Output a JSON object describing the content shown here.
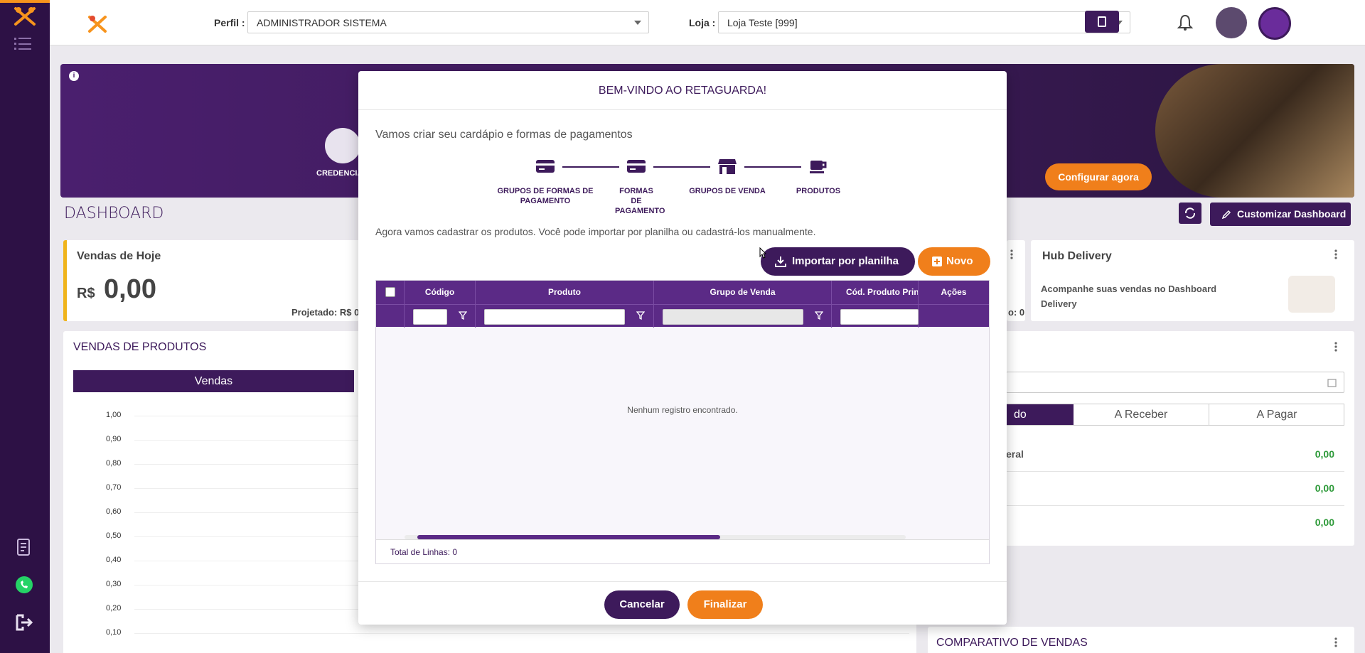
{
  "topbar": {
    "perfil_label": "Perfil :",
    "perfil_value": "ADMINISTRADOR SISTEMA",
    "loja_label": "Loja :",
    "loja_value": "Loja Teste [999]"
  },
  "colors": {
    "brand": "#3d1a5b",
    "accent": "#f07f1b",
    "sidebar": "#2d1145"
  },
  "banner": {
    "credenciar_label": "CREDENCIAR",
    "configure_button": "Configurar agora"
  },
  "dashboard": {
    "title": "DASHBOARD",
    "customize_button": "Customizar Dashboard",
    "vendas_hoje": {
      "title": "Vendas de Hoje",
      "currency": "R$",
      "value": "0,00",
      "projected": "Projetado: R$ 0"
    },
    "hub_delivery": {
      "title": "Hub Delivery",
      "text": "Acompanhe suas vendas no Dashboard Delivery"
    },
    "hub_partial": "o: 0",
    "vendas_produtos": {
      "title": "VENDAS DE PRODUTOS",
      "tab": "Vendas",
      "y_ticks": [
        "1,00",
        "0,90",
        "0,80",
        "0,70",
        "0,60",
        "0,50",
        "0,40",
        "0,30",
        "0,20",
        "0,10"
      ]
    },
    "finance": {
      "tabs": [
        "do",
        "A Receber",
        "A Pagar"
      ],
      "rows": [
        {
          "label": "eral",
          "value": "0,00"
        },
        {
          "label": "",
          "value": "0,00"
        },
        {
          "label": "",
          "value": "0,00"
        }
      ]
    },
    "comparativo": "COMPARATIVO DE VENDAS"
  },
  "modal": {
    "title": "BEM-VINDO AO RETAGUARDA!",
    "subtitle": "Vamos criar seu cardápio e formas de pagamentos",
    "steps": [
      {
        "label": "GRUPOS DE FORMAS DE PAGAMENTO",
        "icon": "credit-card-icon"
      },
      {
        "label": "FORMAS DE PAGAMENTO",
        "icon": "credit-card-icon"
      },
      {
        "label": "GRUPOS DE VENDA",
        "icon": "store-icon"
      },
      {
        "label": "PRODUTOS",
        "icon": "coffee-cup-icon"
      }
    ],
    "instruction": "Agora vamos cadastrar os produtos. Você pode importar por planilha ou cadastrá-los manualmente.",
    "import_button": "Importar por planilha",
    "new_button": "Novo",
    "grid": {
      "columns": [
        "Código",
        "Produto",
        "Grupo de Venda",
        "Cód. Produto Princ",
        "Ações"
      ],
      "empty_text": "Nenhum registro encontrado.",
      "footer_label": "Total de Linhas:",
      "footer_count": "0"
    },
    "cancel_button": "Cancelar",
    "finish_button": "Finalizar"
  }
}
